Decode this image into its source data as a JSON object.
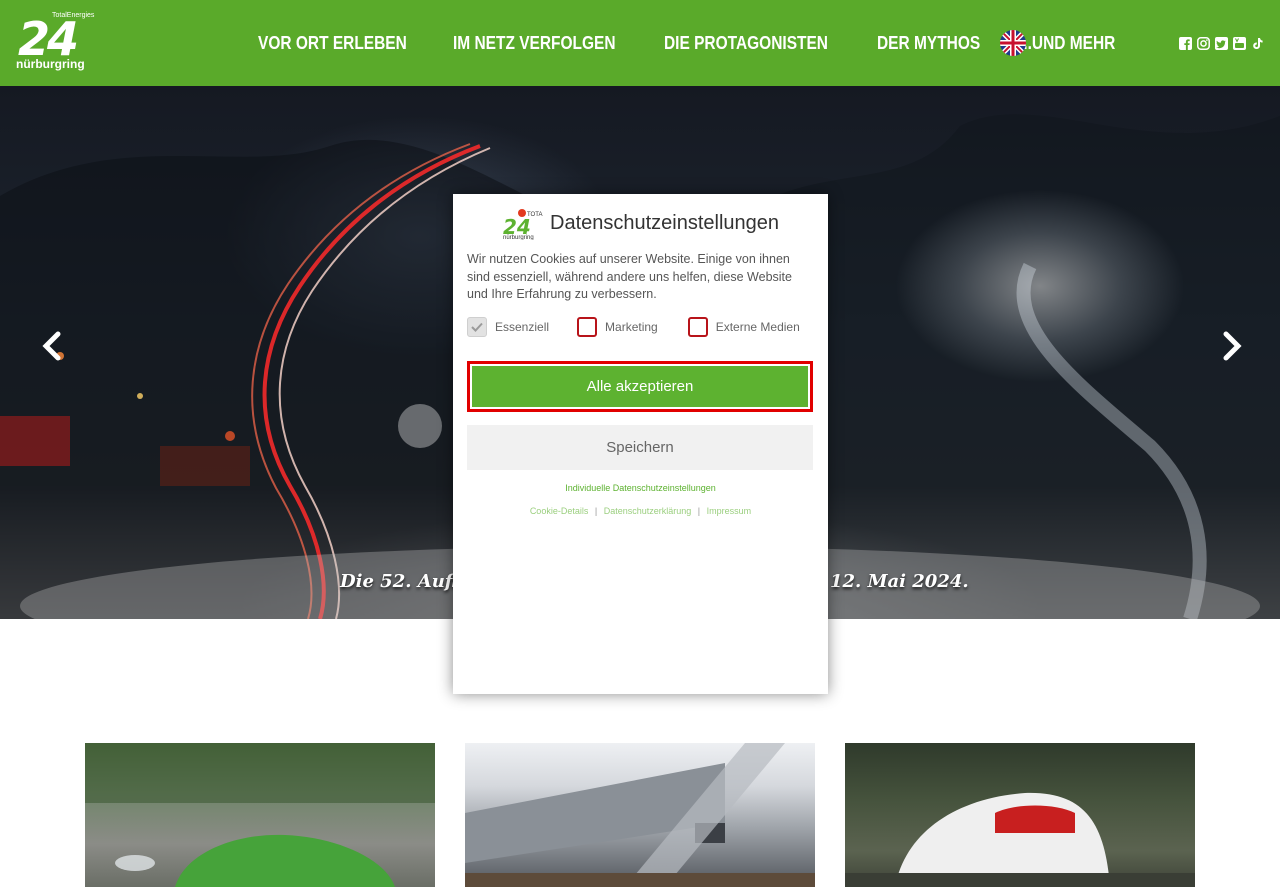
{
  "header": {
    "logo": {
      "brand": "TotalEnergies",
      "numeral": "24",
      "track": "nürburgring"
    },
    "nav": [
      {
        "label": "VOR ORT ERLEBEN"
      },
      {
        "label": "IM NETZ VERFOLGEN"
      },
      {
        "label": "DIE PROTAGONISTEN"
      },
      {
        "label": "DER MYTHOS"
      },
      {
        "label": "...UND MEHR"
      }
    ],
    "language_icon": "uk-flag-icon",
    "socials": [
      "facebook-icon",
      "instagram-icon",
      "twitter-icon",
      "youtube-icon",
      "tiktok-icon"
    ],
    "accent_color": "#5aaa2a"
  },
  "hero": {
    "caption_left": "Die 52. Aufla",
    "caption_right": "12. Mai 2024.",
    "prev_icon": "chevron-left-icon",
    "next_icon": "chevron-right-icon"
  },
  "cookie_modal": {
    "title": "Datenschutzeinstellungen",
    "text": "Wir nutzen Cookies auf unserer Website. Einige von ihnen sind essenziell, während andere uns helfen, diese Website und Ihre Erfahrung zu verbessern.",
    "checkboxes": [
      {
        "label": "Essenziell",
        "checked": true,
        "disabled": true
      },
      {
        "label": "Marketing",
        "checked": false,
        "disabled": false
      },
      {
        "label": "Externe Medien",
        "checked": false,
        "disabled": false
      }
    ],
    "accept_all_label": "Alle akzeptieren",
    "save_label": "Speichern",
    "individual_label": "Individuelle Datenschutzeinstellungen",
    "footer_links": [
      "Cookie-Details",
      "Datenschutzerklärung",
      "Impressum"
    ],
    "button_color": "#5db230",
    "highlight_color": "#e10000"
  }
}
